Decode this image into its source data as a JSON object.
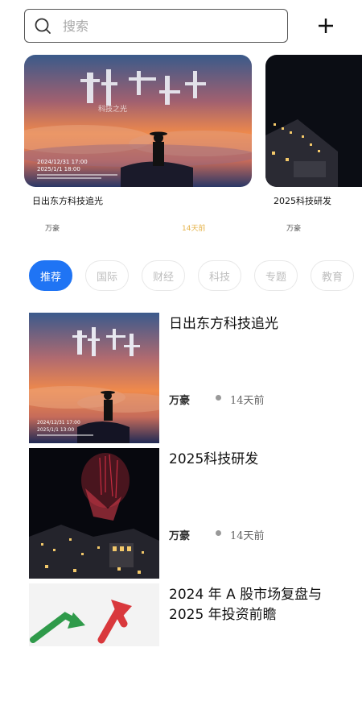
{
  "search": {
    "placeholder": "搜索",
    "icon": "search-icon"
  },
  "header": {
    "add_icon": "plus-icon"
  },
  "carousel": [
    {
      "title": "日出东方科技追光",
      "author": "万豪",
      "time": "14天前",
      "poster_text": {
        "headline": "科技之光",
        "date_line": "2024/12/31 17:00",
        "date_line2": "2025/1/1 18:00"
      }
    },
    {
      "title": "2025科技研发",
      "author": "万豪"
    }
  ],
  "tabs": [
    "推荐",
    "国际",
    "财经",
    "科技",
    "专题",
    "教育"
  ],
  "active_tab": "推荐",
  "news": [
    {
      "title": "日出东方科技追光",
      "author": "万豪",
      "time": "14天前",
      "thumb_text": {
        "date_line": "2024/12/31 17:00",
        "date_line2": "2025/1/1 13:00"
      }
    },
    {
      "title": "2025科技研发",
      "author": "万豪",
      "time": "14天前"
    },
    {
      "title": "2024 年 A 股市场复盘与 2025 年投资前瞻"
    }
  ],
  "colors": {
    "accent": "#1f74f4",
    "time_highlight": "#e5b34a"
  }
}
